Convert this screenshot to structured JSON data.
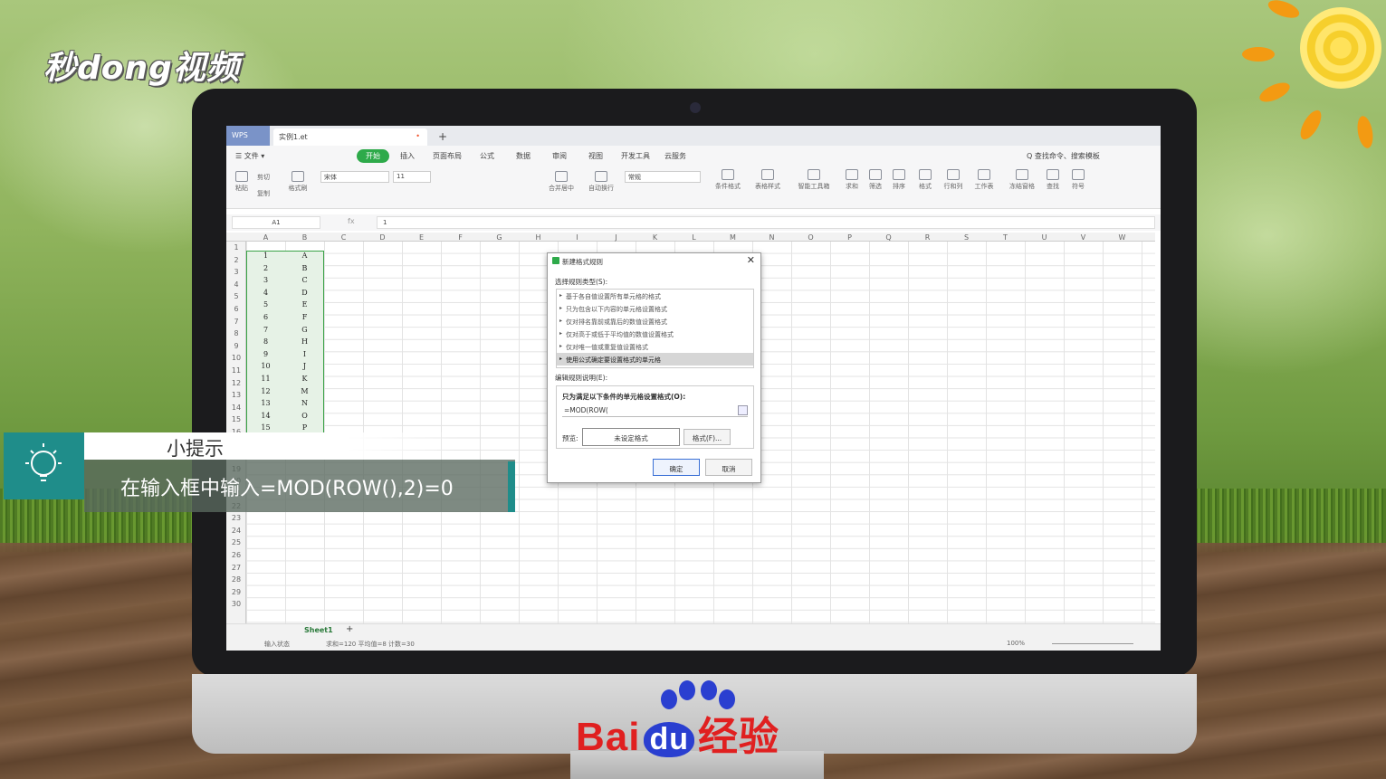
{
  "watermark": {
    "logo": "秒dong视频",
    "brand_left": "Bai",
    "brand_du": "du",
    "brand_right": "经验"
  },
  "tabs": {
    "app": "WPS",
    "file": "实例1.et",
    "dot": "•",
    "add": "+"
  },
  "menu": {
    "file": "☰ 文件 ▾",
    "items": [
      "开始",
      "插入",
      "页面布局",
      "公式",
      "数据",
      "审阅",
      "视图",
      "开发工具",
      "云服务"
    ],
    "search": "Q 查找命令、搜索模板"
  },
  "ribbon": {
    "paste": "粘贴",
    "cut": "剪切",
    "copy": "复制",
    "format_painter": "格式刷",
    "font": "宋体",
    "size": "11",
    "number_format": "常规",
    "merge": "合并居中",
    "wrap": "自动换行",
    "cond_format": "条件格式",
    "table_style": "表格样式",
    "smart_tools": "智能工具箱",
    "sum": "求和",
    "filter": "筛选",
    "sort": "排序",
    "format": "格式",
    "rowcol": "行和列",
    "worksheet": "工作表",
    "freeze": "冻结窗格",
    "find": "查找",
    "symbol": "符号"
  },
  "formula": {
    "cell": "A1",
    "fx": "fx",
    "value": "1"
  },
  "columns": [
    "A",
    "B",
    "C",
    "D",
    "E",
    "F",
    "G",
    "H",
    "I",
    "J",
    "K",
    "L",
    "M",
    "N",
    "O",
    "P",
    "Q",
    "R",
    "S",
    "T",
    "U",
    "V",
    "W"
  ],
  "rows": [
    "1",
    "2",
    "3",
    "4",
    "5",
    "6",
    "7",
    "8",
    "9",
    "10",
    "11",
    "12",
    "13",
    "14",
    "15",
    "16",
    "17",
    "18",
    "19",
    "20",
    "21",
    "22",
    "23",
    "24",
    "25",
    "26",
    "27",
    "28",
    "29",
    "30"
  ],
  "colA": [
    "1",
    "2",
    "3",
    "4",
    "5",
    "6",
    "7",
    "8",
    "9",
    "10",
    "11",
    "12",
    "13",
    "14",
    "15"
  ],
  "colB": [
    "A",
    "B",
    "C",
    "D",
    "E",
    "F",
    "G",
    "H",
    "I",
    "J",
    "K",
    "M",
    "N",
    "O",
    "P"
  ],
  "sheet": {
    "name": "Sheet1",
    "add": "+"
  },
  "status": {
    "mode": "输入状态",
    "stats": "求和=120  平均值=8  计数=30",
    "zoom": "100%"
  },
  "dialog": {
    "title": "新建格式规则",
    "close": "✕",
    "select_label": "选择规则类型(S):",
    "rules": [
      "基于各自值设置所有单元格的格式",
      "只为包含以下内容的单元格设置格式",
      "仅对排名靠前或靠后的数值设置格式",
      "仅对高于或低于平均值的数值设置格式",
      "仅对唯一值或重复值设置格式",
      "使用公式确定要设置格式的单元格"
    ],
    "edit_label": "编辑规则说明(E):",
    "cond_label": "只为满足以下条件的单元格设置格式(O):",
    "cond_value": "=MOD(ROW(",
    "preview_label": "预览:",
    "preview_text": "未设定格式",
    "format_btn": "格式(F)...",
    "ok": "确定",
    "cancel": "取消"
  },
  "tip": {
    "title": "小提示",
    "body": "在输入框中输入=MOD(ROW(),2)=0"
  },
  "colors": {
    "accent_green": "#2eaa4a",
    "tip_teal": "#1f8d8a",
    "baidu_red": "#e02020",
    "baidu_blue": "#2a3fd0"
  }
}
